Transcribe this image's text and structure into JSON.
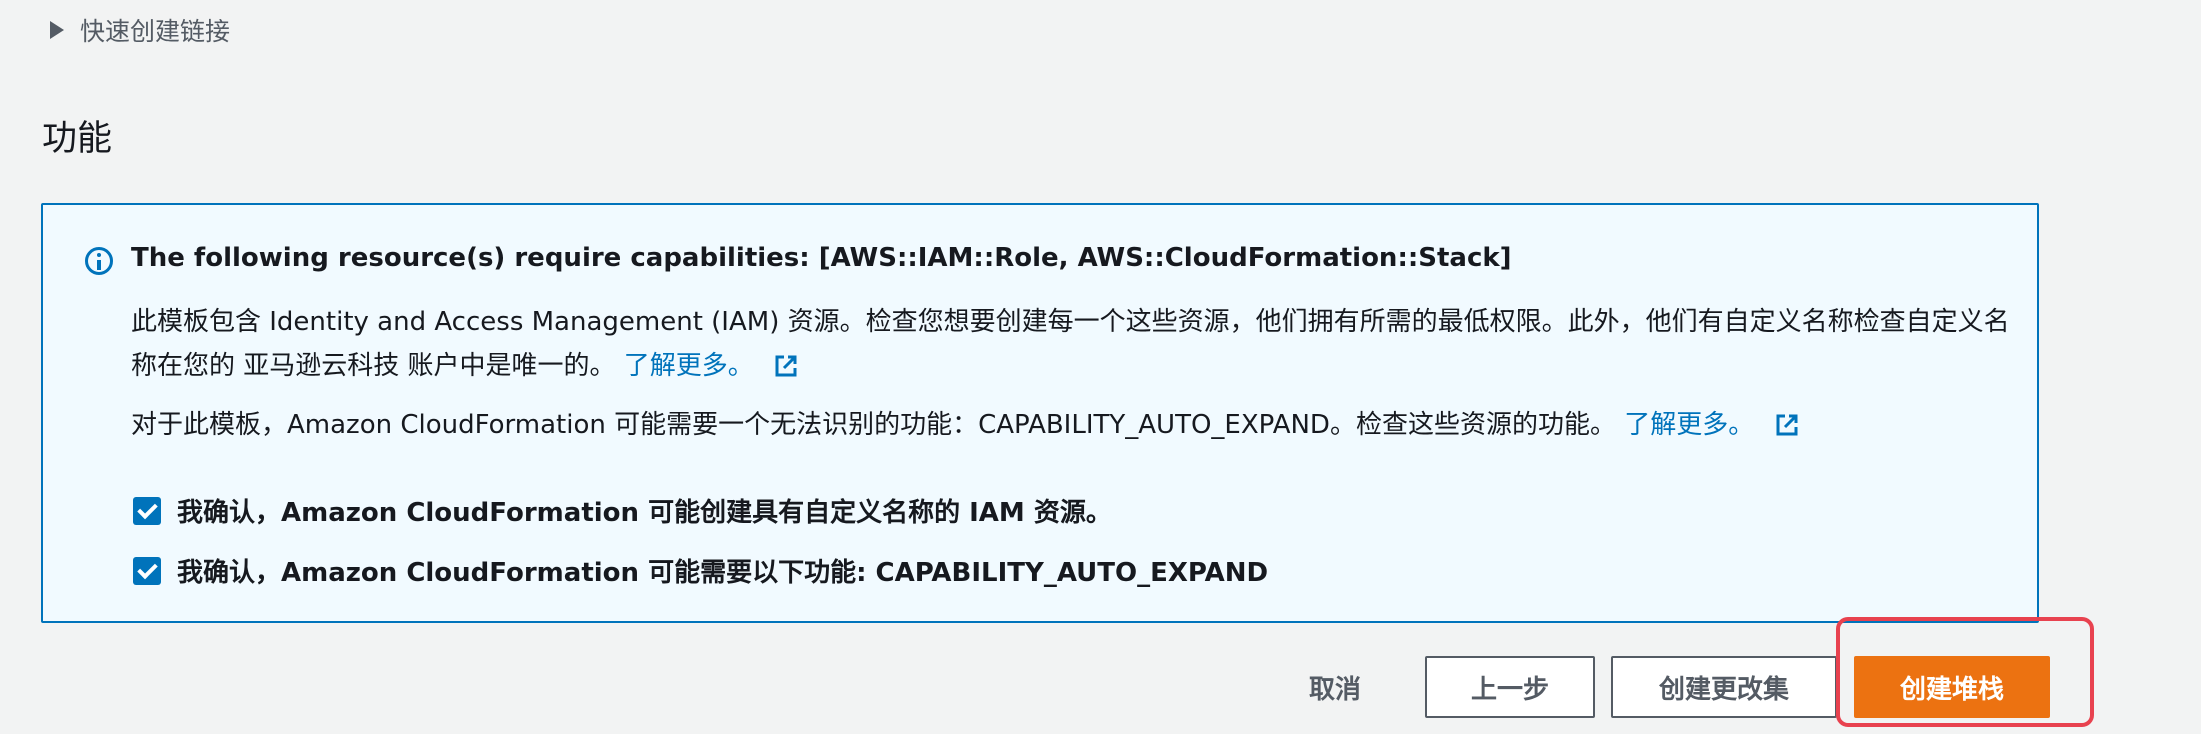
{
  "quick_link": {
    "label": "快速创建链接"
  },
  "section": {
    "title": "功能"
  },
  "info_box": {
    "heading": "The following resource(s) require capabilities: [AWS::IAM::Role, AWS::CloudFormation::Stack]",
    "para1_text": "此模板包含 Identity and Access Management (IAM) 资源。检查您想要创建每一个这些资源，他们拥有所需的最低权限。此外，他们有自定义名称检查自定义名称在您的 亚马逊云科技 账户中是唯一的。",
    "para1_link": "了解更多。",
    "para2_text": "对于此模板，Amazon CloudFormation 可能需要一个无法识别的功能：CAPABILITY_AUTO_EXPAND。检查这些资源的功能。",
    "para2_link": "了解更多。"
  },
  "checkboxes": [
    {
      "label": "我确认，Amazon CloudFormation 可能创建具有自定义名称的 IAM 资源。",
      "checked": true
    },
    {
      "label": "我确认，Amazon CloudFormation 可能需要以下功能: CAPABILITY_AUTO_EXPAND",
      "checked": true
    }
  ],
  "buttons": {
    "cancel": "取消",
    "previous": "上一步",
    "create_changeset": "创建更改集",
    "create_stack": "创建堆栈"
  },
  "colors": {
    "accent": "#0073bb",
    "primary_button": "#ec7211",
    "highlight": "#e8424f",
    "info_bg": "#f1faff"
  }
}
